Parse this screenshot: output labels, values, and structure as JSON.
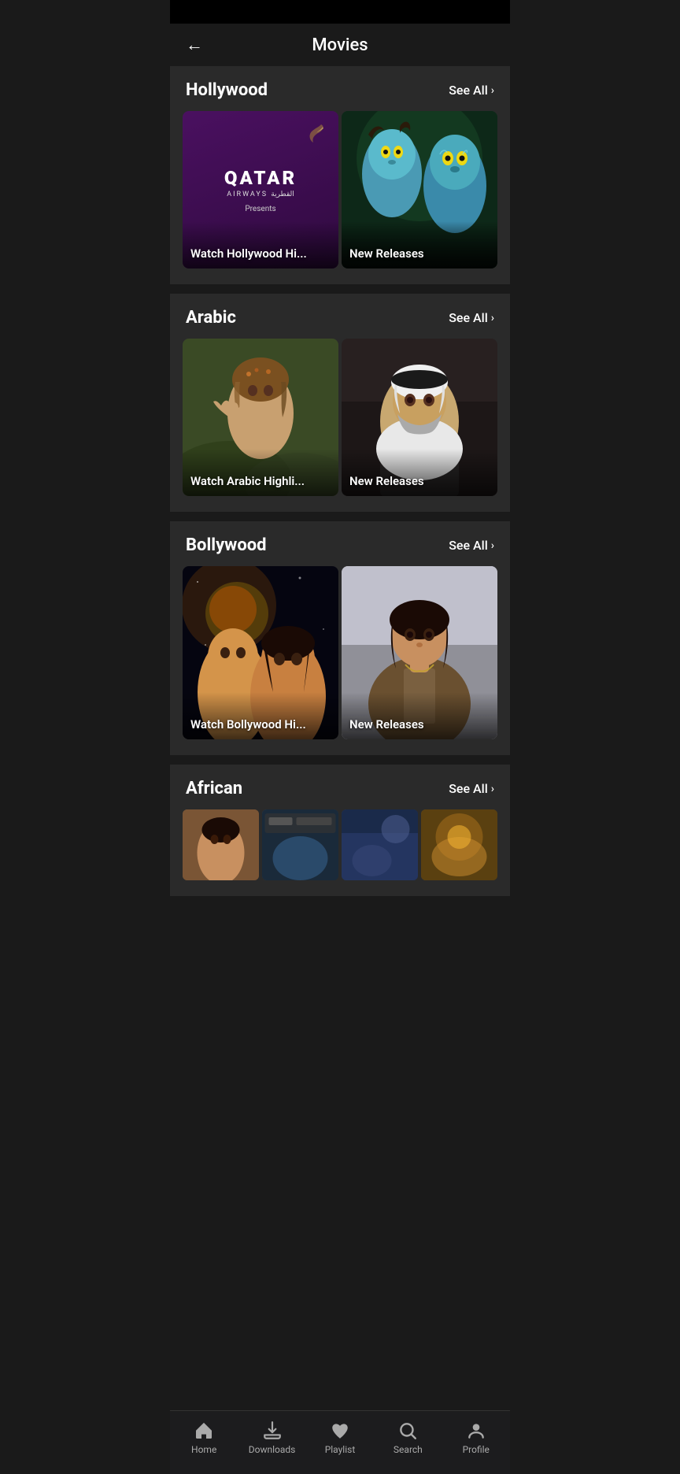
{
  "header": {
    "title": "Movies",
    "back_label": "←"
  },
  "sections": [
    {
      "id": "hollywood",
      "title": "Hollywood",
      "see_all": "See All",
      "cards": [
        {
          "id": "qatar-highlights",
          "label": "Watch Hollywood Hi...",
          "type": "qatar"
        },
        {
          "id": "hollywood-new-releases",
          "label": "New Releases",
          "type": "avatar"
        }
      ]
    },
    {
      "id": "arabic",
      "title": "Arabic",
      "see_all": "See All",
      "cards": [
        {
          "id": "arabic-highlights",
          "label": "Watch Arabic Highli...",
          "type": "arabic1"
        },
        {
          "id": "arabic-new-releases",
          "label": "New Releases",
          "type": "arabic2"
        }
      ]
    },
    {
      "id": "bollywood",
      "title": "Bollywood",
      "see_all": "See All",
      "cards": [
        {
          "id": "bollywood-highlights",
          "label": "Watch Bollywood Hi...",
          "type": "bolly1"
        },
        {
          "id": "bollywood-new-releases",
          "label": "New Releases",
          "type": "bolly2"
        }
      ]
    },
    {
      "id": "african",
      "title": "African",
      "see_all": "See All",
      "cards": [
        {
          "id": "af1",
          "type": "af1"
        },
        {
          "id": "af2",
          "type": "af2"
        },
        {
          "id": "af3",
          "type": "af3"
        },
        {
          "id": "af4",
          "type": "af4"
        }
      ]
    }
  ],
  "nav": {
    "items": [
      {
        "id": "home",
        "label": "Home",
        "icon": "home",
        "active": false
      },
      {
        "id": "downloads",
        "label": "Downloads",
        "icon": "download",
        "active": false
      },
      {
        "id": "playlist",
        "label": "Playlist",
        "icon": "heart",
        "active": false
      },
      {
        "id": "search",
        "label": "Search",
        "icon": "search",
        "active": false
      },
      {
        "id": "profile",
        "label": "Profile",
        "icon": "person",
        "active": false
      }
    ]
  }
}
